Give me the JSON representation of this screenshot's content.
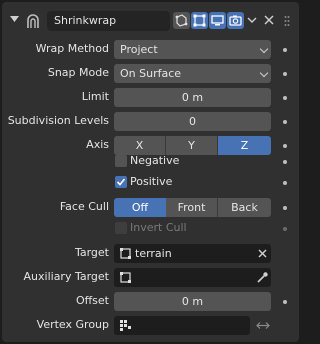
{
  "modifier": {
    "name": "Shrinkwrap",
    "icons": [
      "collapse-arrow-icon",
      "shrinkwrap-modifier-icon",
      "edit-mode-cage-icon",
      "edit-mode-icon",
      "realtime-viewport-icon",
      "render-camera-icon",
      "dropdown-icon",
      "close-icon"
    ]
  },
  "fields": {
    "wrap_method": {
      "label": "Wrap Method",
      "value": "Project"
    },
    "snap_mode": {
      "label": "Snap Mode",
      "value": "On Surface"
    },
    "limit": {
      "label": "Limit",
      "value": "0 m"
    },
    "subdivision_levels": {
      "label": "Subdivision Levels",
      "value": "0"
    },
    "axis": {
      "label": "Axis",
      "options": [
        "X",
        "Y",
        "Z"
      ],
      "selected": "Z"
    },
    "negative": {
      "label": "Negative",
      "checked": false
    },
    "positive": {
      "label": "Positive",
      "checked": true
    },
    "face_cull": {
      "label": "Face Cull",
      "options": [
        "Off",
        "Front",
        "Back"
      ],
      "selected": "Off"
    },
    "invert_cull": {
      "label": "Invert Cull",
      "checked": false,
      "disabled": true
    },
    "target": {
      "label": "Target",
      "value": "terrain"
    },
    "auxiliary_target": {
      "label": "Auxiliary Target",
      "value": ""
    },
    "offset": {
      "label": "Offset",
      "value": "0 m"
    },
    "vertex_group": {
      "label": "Vertex Group",
      "value": ""
    }
  },
  "colors": {
    "panel_bg": "#303030",
    "field_bg": "#545454",
    "active_blue": "#4772b3",
    "dark_field": "#1d1d1d"
  }
}
